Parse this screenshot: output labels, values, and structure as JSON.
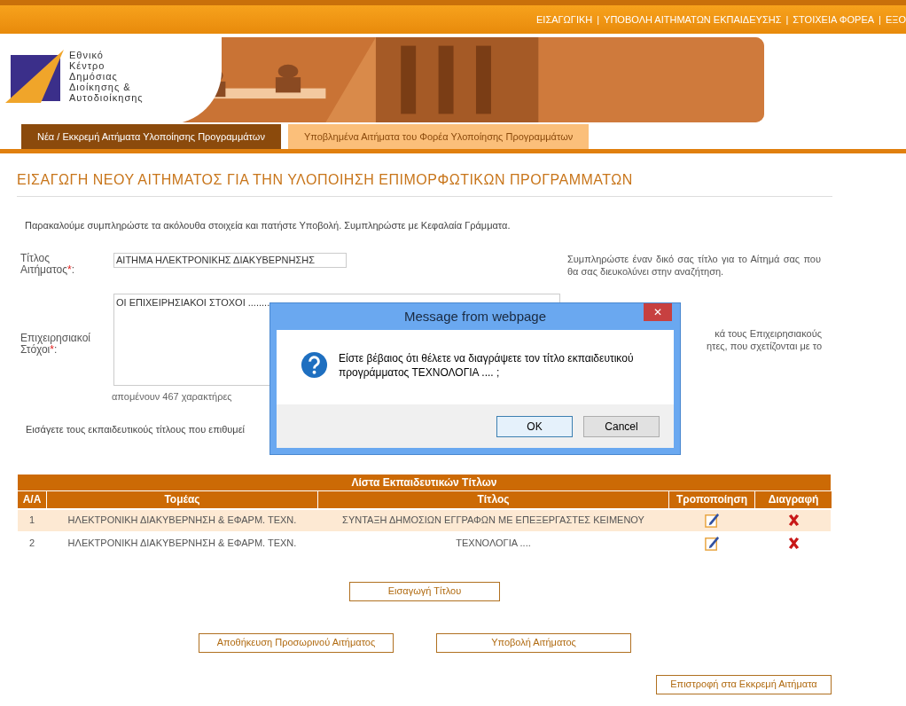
{
  "top_nav": [
    {
      "label": "ΕΙΣΑΓΩΓΙΚΗ"
    },
    {
      "label": "ΥΠΟΒΟΛΗ ΑΙΤΗΜΑΤΩΝ ΕΚΠΑΙΔΕΥΣΗΣ"
    },
    {
      "label": "ΣΤΟΙΧΕΙΑ ΦΟΡΕΑ"
    },
    {
      "label": "ΕΞΟ"
    }
  ],
  "nav_separator": "|",
  "logo": {
    "lines": [
      "Εθνικό",
      "Κέντρο",
      "Δημόσιας",
      "Διοίκησης &",
      "Αυτοδιοίκησης"
    ]
  },
  "tabs": [
    {
      "label": "Νέα / Εκκρεμή Αιτήματα Υλοποίησης Προγραμμάτων",
      "selected": true
    },
    {
      "label": "Υποβλημένα Αιτήματα του Φορέα Υλοποίησης Προγραμμάτων",
      "selected": false
    }
  ],
  "page_title": "ΕΙΣΑΓΩΓΗ ΝΕΟΥ ΑΙΤΗΜΑΤΟΣ ΓΙΑ ΤΗΝ ΥΛΟΠΟΙΗΣΗ ΕΠΙΜΟΡΦΩΤΙΚΩΝ ΠΡΟΓΡΑΜΜΑΤΩΝ",
  "intro": "Παρακαλούμε συμπληρώστε τα ακόλουθα στοιχεία και πατήστε Υποβολή. Συμπληρώστε με Κεφαλαία Γράμματα.",
  "form": {
    "title_label": [
      "Τίτλος",
      "Αιτήματος"
    ],
    "title_value": "ΑΙΤΗΜΑ ΗΛΕΚΤΡΟΝΙΚΗΣ ΔΙΑΚΥΒΕΡΝΗΣΗΣ",
    "title_help": "Συμπληρώστε έναν δικό σας τίτλο για το Αίτημά σας που θα σας διευκολύνει στην αναζήτηση.",
    "goals_label": [
      "Επιχειρησιακοί",
      "Στόχοι"
    ],
    "goals_value": "ΟΙ ΕΠΙΧΕΙΡΗΣΙΑΚΟΙ ΣΤΟΧΟΙ ........",
    "goals_help": [
      "κά τους Επιχειρησιακούς",
      "ητες, που σχετίζονται με το"
    ],
    "required_mark": "*",
    "colon": ":",
    "remaining": "απομένουν 467 χαρακτήρες"
  },
  "titles_hint": "Εισάγετε τους εκπαιδευτικούς τίτλους που επιθυμεί",
  "table": {
    "caption": "Λίστα Εκπαιδευτικών Τίτλων",
    "columns": [
      "Α/Α",
      "Τομέας",
      "Τίτλος",
      "Τροποποίηση",
      "Διαγραφή"
    ],
    "rows": [
      {
        "cells": [
          "1",
          "ΗΛΕΚΤΡΟΝΙΚΗ ΔΙΑΚΥΒΕΡΝΗΣΗ & ΕΦΑΡΜ. ΤΕΧΝ.",
          "ΣΥΝΤΑΞΗ ΔΗΜΟΣΙΩΝ ΕΓΓΡΑΦΩΝ ΜΕ ΕΠΕΞΕΡΓΑΣΤΕΣ ΚΕΙΜΕΝΟΥ"
        ],
        "selected": true
      },
      {
        "cells": [
          "2",
          "ΗΛΕΚΤΡΟΝΙΚΗ ΔΙΑΚΥΒΕΡΝΗΣΗ & ΕΦΑΡΜ. ΤΕΧΝ.",
          "ΤΕΧΝΟΛΟΓΙΑ ...."
        ],
        "selected": false
      }
    ]
  },
  "buttons": {
    "add_title": "Εισαγωγή Τίτλου",
    "save_draft": "Αποθήκευση Προσωρινού Αιτήματος",
    "submit": "Υποβολή Αιτήματος",
    "back": "Επιστροφή στα Εκκρεμή Αιτήματα"
  },
  "dialog": {
    "title": "Message from webpage",
    "close": "✕",
    "message": "Είστε βέβαιος ότι θέλετε να διαγράψετε τον τίτλο εκπαιδευτικού προγράμματος ΤΕΧΝΟΛΟΓΙΑ .... ;",
    "buttons": [
      "OK",
      "Cancel"
    ]
  }
}
